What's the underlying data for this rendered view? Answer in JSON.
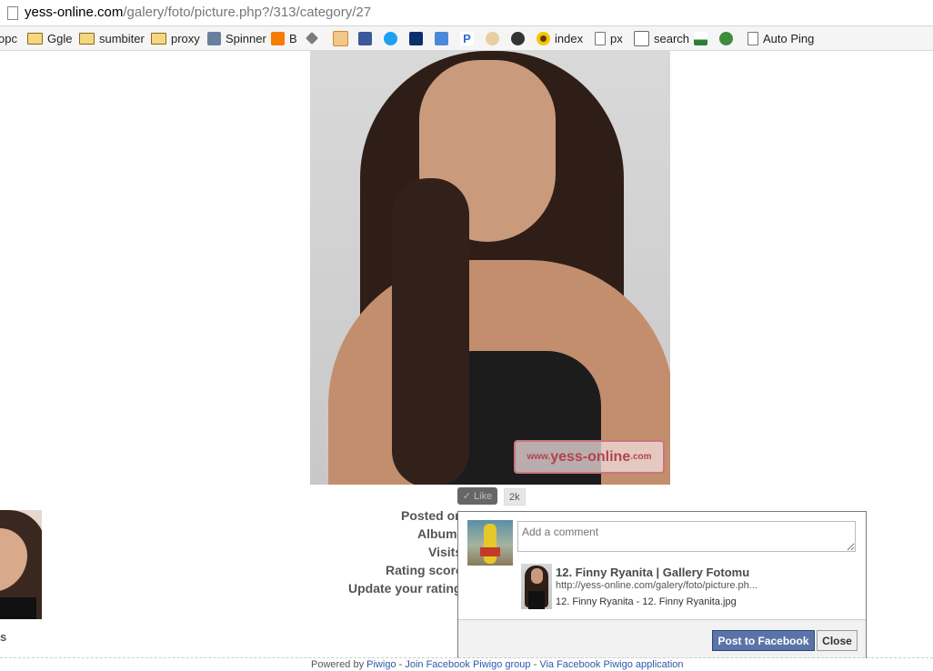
{
  "browser": {
    "url_host": "yess-online.com",
    "url_path": "/galery/foto/picture.php?/313/category/27"
  },
  "bookmarks": [
    {
      "label": "opc",
      "icon": "none"
    },
    {
      "label": "Ggle",
      "icon": "folder-icon"
    },
    {
      "label": "sumbiter",
      "icon": "folder-icon"
    },
    {
      "label": "proxy",
      "icon": "folder-icon"
    },
    {
      "label": "Spinner",
      "icon": "spinner-icon"
    },
    {
      "label": "B",
      "icon": "blogger-icon"
    },
    {
      "label": "",
      "icon": "pin-icon"
    },
    {
      "label": "",
      "icon": "mail-icon"
    },
    {
      "label": "",
      "icon": "facebook-icon"
    },
    {
      "label": "",
      "icon": "twitter-icon"
    },
    {
      "label": "",
      "icon": "bookmark-icon"
    },
    {
      "label": "",
      "icon": "share-icon"
    },
    {
      "label": "",
      "icon": "p-icon"
    },
    {
      "label": "",
      "icon": "hand-icon"
    },
    {
      "label": "",
      "icon": "camera-icon"
    },
    {
      "label": "index",
      "icon": "sunflower-icon"
    },
    {
      "label": "px",
      "icon": "page-icon"
    },
    {
      "label": "search",
      "icon": "search-icon"
    },
    {
      "label": "",
      "icon": "graph-icon"
    },
    {
      "label": "",
      "icon": "globe-icon"
    },
    {
      "label": "Auto Ping",
      "icon": "page-icon"
    }
  ],
  "photo": {
    "watermark_prefix": "www.",
    "watermark_main": "yess-online",
    "watermark_suffix": ".com"
  },
  "like": {
    "label": "Like",
    "count": "2k"
  },
  "info": {
    "posted": "Posted or",
    "albums": "Albums",
    "visits": "Visits",
    "rating": "Rating score",
    "update": "Update your rating",
    "left_cut": "s"
  },
  "fb_dialog": {
    "comment_placeholder": "Add a comment",
    "title": "12. Finny Ryanita | Gallery Fotomu",
    "link": "http://yess-online.com/galery/foto/picture.ph...",
    "description": "12. Finny Ryanita - 12. Finny Ryanita.jpg",
    "post_label": "Post to Facebook",
    "close_label": "Close"
  },
  "footer": {
    "powered_by": "Powered by",
    "piwigo": "Piwigo",
    "sep1": " - ",
    "join": "Join Facebook Piwigo group",
    "sep2": " - ",
    "via": "Via Facebook Piwigo application"
  }
}
